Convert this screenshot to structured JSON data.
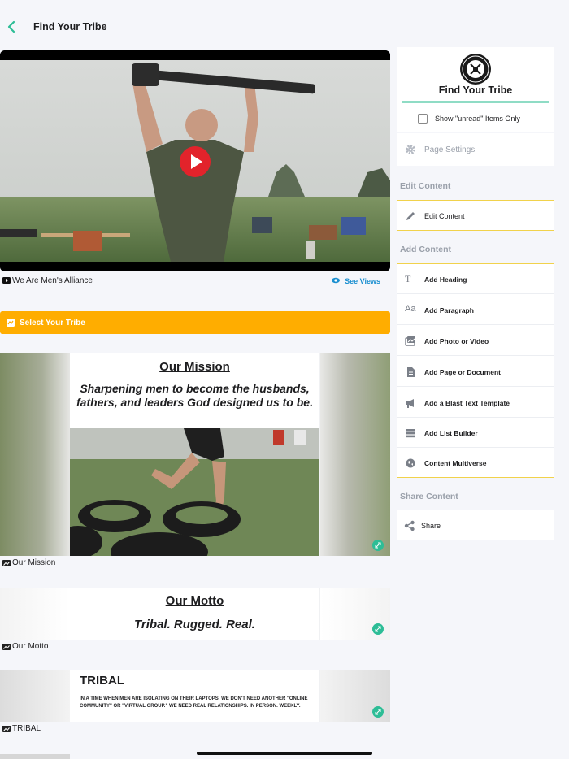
{
  "header": {
    "title": "Find Your Tribe"
  },
  "video": {
    "caption": "We Are Men's Alliance",
    "see_views": "See Views"
  },
  "tribe_button": {
    "label": "Select Your Tribe"
  },
  "cards": {
    "mission": {
      "heading": "Our Mission",
      "text": "Sharpening men to become the husbands, fathers, and leaders God designed us to be.",
      "caption": "Our Mission"
    },
    "motto": {
      "heading": "Our Motto",
      "text": "Tribal. Rugged. Real.",
      "caption": "Our Motto"
    },
    "tribal": {
      "heading": "TRIBAL",
      "text": "IN A TIME WHEN MEN ARE ISOLATING ON THEIR LAPTOPS, WE DON'T NEED ANOTHER \"ONLINE COMMUNITY\" OR \"VIRTUAL GROUP.\" WE NEED REAL RELATIONSHIPS. IN PERSON. WEEKLY.",
      "caption": "TRIBAL"
    }
  },
  "sidebar": {
    "title": "Find Your Tribe",
    "unread_label": "Show \"unread\" Items Only",
    "page_settings": "Page Settings",
    "edit_section": "Edit Content",
    "edit_item": "Edit Content",
    "add_section": "Add Content",
    "add_items": [
      {
        "label": "Add Heading",
        "icon": "heading-icon"
      },
      {
        "label": "Add Paragraph",
        "icon": "paragraph-icon"
      },
      {
        "label": "Add Photo or Video",
        "icon": "photo-icon"
      },
      {
        "label": "Add Page or Document",
        "icon": "document-icon"
      },
      {
        "label": "Add a Blast Text Template",
        "icon": "megaphone-icon"
      },
      {
        "label": "Add List Builder",
        "icon": "list-icon"
      },
      {
        "label": "Content Multiverse",
        "icon": "globe-icon"
      }
    ],
    "share_section": "Share Content",
    "share_item": "Share"
  },
  "colors": {
    "accent": "#2dbd96",
    "tribe_button": "#ffad00",
    "highlight_border": "#f1d24b",
    "link": "#1a8fd0"
  }
}
